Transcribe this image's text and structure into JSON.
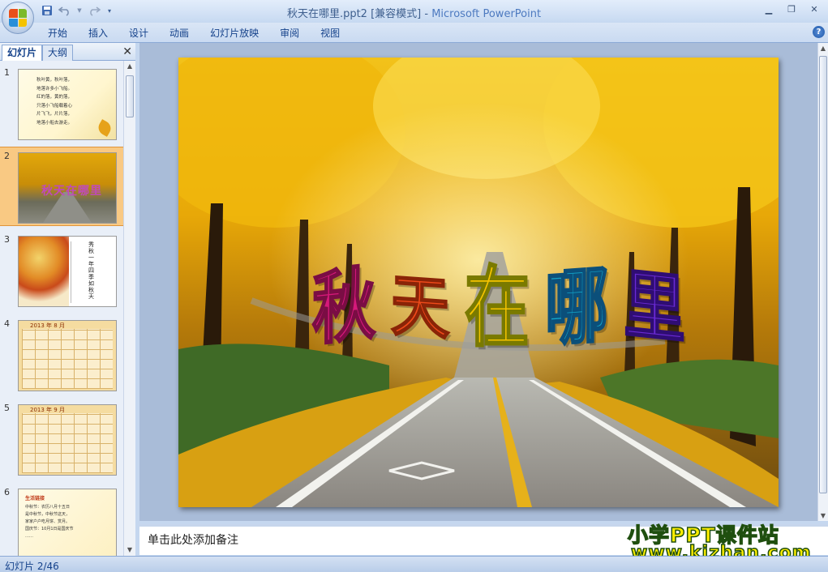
{
  "window": {
    "doc_title": "秋天在哪里.ppt2 [兼容模式]",
    "separator": " - ",
    "app_name": "Microsoft PowerPoint"
  },
  "icons": {
    "office_button": "office-logo-icon",
    "save": "save-icon",
    "undo": "undo-icon",
    "redo": "redo-icon",
    "qat_dropdown": "chevron-down-icon",
    "minimize": "minimize-icon",
    "restore": "restore-icon",
    "close": "close-icon",
    "help": "help-icon"
  },
  "ribbon": {
    "tabs": [
      {
        "label": "开始"
      },
      {
        "label": "插入"
      },
      {
        "label": "设计"
      },
      {
        "label": "动画"
      },
      {
        "label": "幻灯片放映"
      },
      {
        "label": "审阅"
      },
      {
        "label": "视图"
      }
    ],
    "help_label": "?"
  },
  "left_pane": {
    "tab_slides": "幻灯片",
    "tab_outline": "大纲",
    "close_glyph": "✕",
    "slides": [
      {
        "num": "1",
        "lines": [
          "秋叶黄，秋叶落，",
          "地落许多小飞船。",
          "红的落，黄的落，",
          "只落小飞船载着心",
          "片飞飞，片片落，",
          "地落小船去游走。"
        ]
      },
      {
        "num": "2",
        "title": "秋天在哪里"
      },
      {
        "num": "3",
        "right_text": [
          "秀",
          "秋",
          "一",
          "年",
          "四",
          "季",
          "如",
          "秋",
          "天"
        ]
      },
      {
        "num": "4",
        "calendar_title": "2013 年 8 月"
      },
      {
        "num": "5",
        "calendar_title": "2013 年 9 月"
      },
      {
        "num": "6",
        "header": "生活链接",
        "lines": [
          "中秋节：农历八月十五日",
          "是中秋节，中秋节这天，",
          "家家户户吃月饼、赏月。",
          "国庆节：10月1日是国庆节",
          "……"
        ]
      }
    ],
    "selected_index": 1
  },
  "current_slide": {
    "wordart_chars": [
      "秋",
      "天",
      "在",
      "哪",
      "里"
    ],
    "wordart_colors": [
      "#d6197a",
      "#f04a1a",
      "#f5c300",
      "#12a4c8",
      "#6a2ad4"
    ]
  },
  "notes": {
    "placeholder": "单击此处添加备注"
  },
  "watermark": {
    "line1": "小学PPT课件站",
    "line2": "www.kjzhan.com"
  },
  "status": {
    "slide_indicator": "幻灯片 2/46"
  },
  "colors": {
    "ribbon_text": "#15428b",
    "selection": "#f9c983",
    "foliage": "#e8b10a"
  }
}
